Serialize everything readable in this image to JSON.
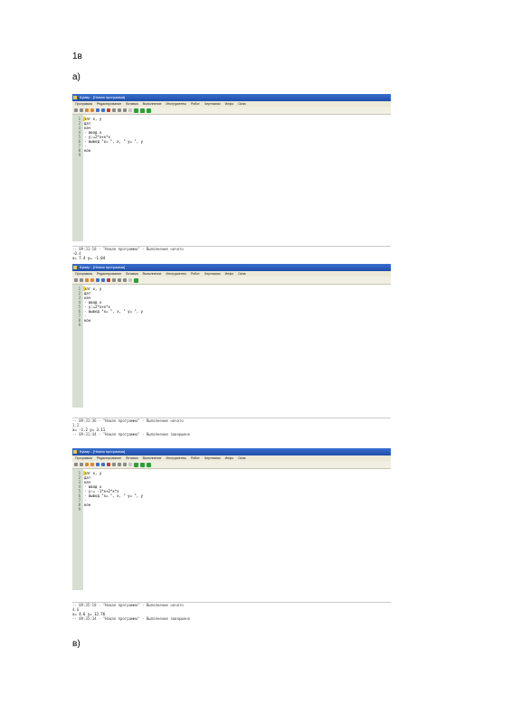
{
  "doc": {
    "heading": "1в",
    "label_a": "а)",
    "label_b": "в)"
  },
  "app": {
    "title": "Кумир - [Новая программа]",
    "menu": [
      "Программа",
      "Редактирование",
      "Вставка",
      "Выполнение",
      "Инструменты",
      "Робот",
      "Чертежник",
      "Инфо",
      "Окна"
    ]
  },
  "shots": [
    {
      "code": [
        {
          "num": "1",
          "text": "алг х, у",
          "cursor": true
        },
        {
          "num": "2",
          "text": "дат"
        },
        {
          "num": "3",
          "text": "нач"
        },
        {
          "num": "4",
          "text": "· ввод х"
        },
        {
          "num": "5",
          "text": "· у:=2*х+х*х"
        },
        {
          "num": "6",
          "text": "· вывод \"х= \", х, \" у= \", у"
        },
        {
          "num": "7",
          "text": "·"
        },
        {
          "num": "8",
          "text": "кон"
        },
        {
          "num": "9",
          "text": ""
        }
      ],
      "output": [
        "-- 09:31:18 - \"Новая программа\" - Выполнение начато",
        "-0.4"
      ],
      "result": "х= 7.4 у= -1.04",
      "footer": ""
    },
    {
      "code": [
        {
          "num": "1",
          "text": "алг х, у",
          "cursor": true
        },
        {
          "num": "2",
          "text": "дат"
        },
        {
          "num": "3",
          "text": "нач"
        },
        {
          "num": "4",
          "text": "· ввод х"
        },
        {
          "num": "5",
          "text": "· у:=2*х+х*х"
        },
        {
          "num": "6",
          "text": "· вывод \"х= \", х, \" у= \", у"
        },
        {
          "num": "7",
          "text": "·"
        },
        {
          "num": "8",
          "text": "кон"
        },
        {
          "num": "9",
          "text": ""
        }
      ],
      "output": [
        "-- 09:31:36 - \"Новая программа\" - Выполнение начато",
        "1.2"
      ],
      "result": "х= -1.2 у= 3.11",
      "footer": "-- 09:31:44 - \"Новая программа\" - Выполнение завершено"
    },
    {
      "code": [
        {
          "num": "1",
          "text": "алг х, у",
          "cursor": true
        },
        {
          "num": "2",
          "text": "дат"
        },
        {
          "num": "3",
          "text": "нач"
        },
        {
          "num": "4",
          "text": "· ввод х"
        },
        {
          "num": "5",
          "text": "· у:= -1*х+2*х*х"
        },
        {
          "num": "6",
          "text": "· вывод \"х= \", х, \" у= \", у"
        },
        {
          "num": "7",
          "text": "·"
        },
        {
          "num": "8",
          "text": "кон"
        },
        {
          "num": "9",
          "text": ""
        }
      ],
      "output": [
        "-- 09:35:18 - \"Новая программа\" - Выполнение начато",
        "4.6"
      ],
      "result": "х= 4.6 у= 12.76",
      "footer": "-- 09:35:34 - \"Новая программа\" - Выполнение завершено"
    }
  ]
}
